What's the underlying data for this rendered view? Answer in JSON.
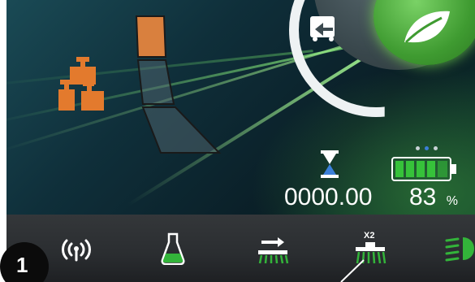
{
  "status": {
    "hour_meter_value": "0000.00",
    "battery_percent": "83",
    "battery_unit": "%"
  },
  "callout": {
    "number": "1"
  },
  "icons": {
    "weight": "weight-stack-icon",
    "speed_gauge": "speed-gauge-icon",
    "drive_mode": "reverse-drive-icon",
    "eco_mode": "eco-leaf-icon",
    "hourglass": "hourglass-icon",
    "battery": "battery-icon",
    "wireless": "wireless-icon",
    "detergent": "detergent-flask-icon",
    "scrub": "scrub-brush-icon",
    "scrub_x2": "scrub-brush-x2-icon",
    "lights": "headlights-icon"
  },
  "labels": {
    "scrub_x2_badge": "X2"
  },
  "colors": {
    "orange": "#e37a2d",
    "green": "#33b43a",
    "white": "#ffffff",
    "dark": "#2b2f33"
  }
}
